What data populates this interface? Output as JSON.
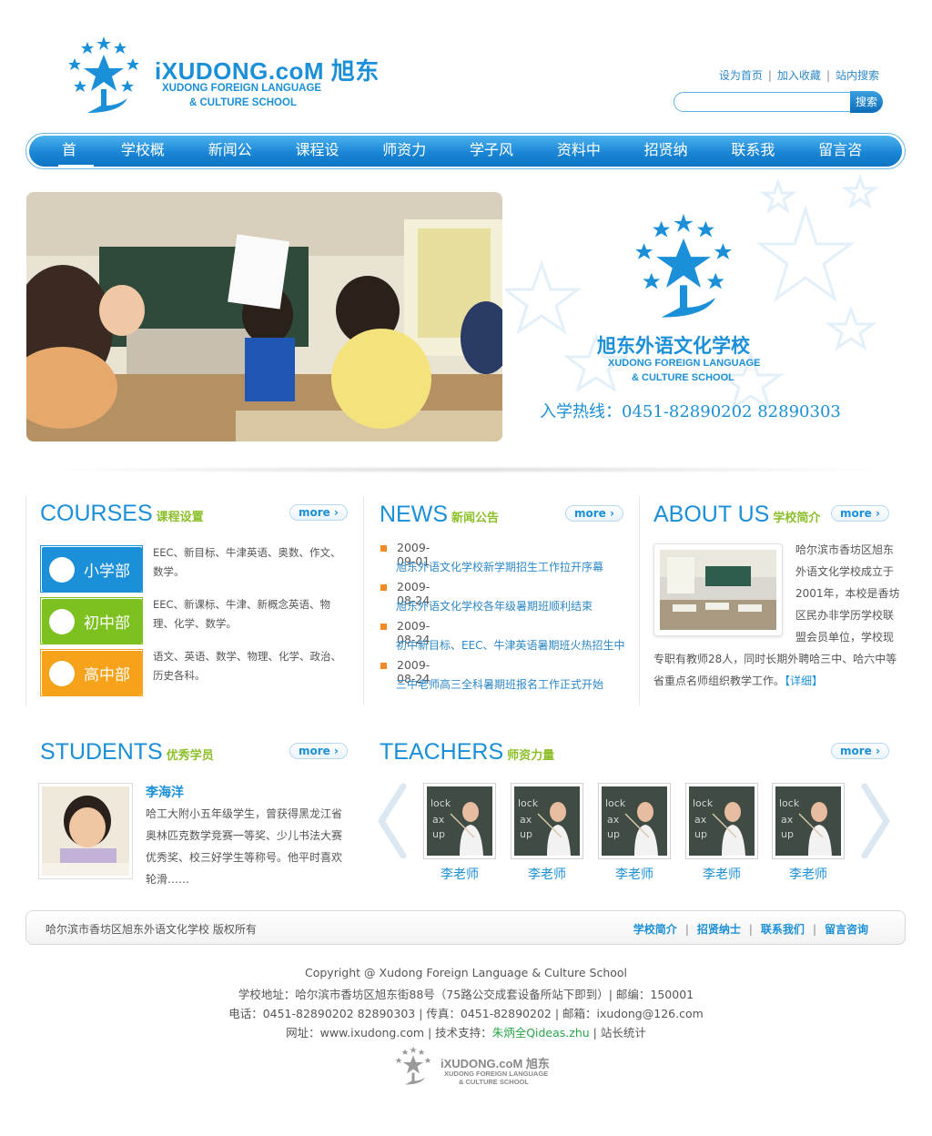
{
  "header": {
    "brand": "iXUDONG.coM 旭东",
    "brand_sub_1": "XUDONG FOREIGN LANGUAGE",
    "brand_sub_2": "& CULTURE SCHOOL",
    "top_links": [
      "设为首页",
      "加入收藏",
      "站内搜索"
    ],
    "search": {
      "placeholder": "",
      "button_label": "搜索"
    }
  },
  "nav": {
    "items": [
      "首页",
      "学校概况",
      "新闻公告",
      "课程设置",
      "师资力量",
      "学子风采",
      "资料中心",
      "招贤纳士",
      "联系我们",
      "留言咨询"
    ],
    "active_index": 0
  },
  "banner": {
    "school_name_cn": "旭东外语文化学校",
    "school_name_en_1": "XUDONG FOREIGN LANGUAGE",
    "school_name_en_2": "& CULTURE SCHOOL",
    "hotline": "入学热线：0451-82890202 82890303"
  },
  "courses": {
    "title": "COURSES",
    "subtitle": "课程设置",
    "more_label": "more",
    "items": [
      {
        "label": "小学部",
        "desc": "EEC、新目标、牛津英语、奥数、作文、数学。",
        "color": "#1b8fd8"
      },
      {
        "label": "初中部",
        "desc": "EEC、新课标、牛津、新概念英语、物理、化学、数学。",
        "color": "#7cc11f"
      },
      {
        "label": "高中部",
        "desc": "语文、英语、数学、物理、化学、政治、历史各科。",
        "color": "#f7a21b"
      }
    ]
  },
  "news": {
    "title": "NEWS",
    "subtitle": "新闻公告",
    "more_label": "more",
    "items": [
      {
        "date": "2009-09-01",
        "title": "旭东外语文化学校新学期招生工作拉开序幕"
      },
      {
        "date": "2009-08-24",
        "title": "旭东外语文化学校各年级暑期班顺利结束"
      },
      {
        "date": "2009-08-24",
        "title": "初中新目标、EEC、牛津英语暑期班火热招生中"
      },
      {
        "date": "2009-08-24",
        "title": "三中老师高三全科暑期班报名工作正式开始"
      }
    ]
  },
  "about": {
    "title": "ABOUT US",
    "subtitle": "学校简介",
    "more_label": "more",
    "text_side": [
      "哈尔滨市香坊区旭东",
      "外语文化学校成立于",
      "2001年，本校是香坊",
      "区民办非学历学校联",
      "盟会员单位，学校现"
    ],
    "text_full": [
      "专职有教师28人，同时长期外聘哈三中、哈六中等",
      "省重点名师组织教学工作。"
    ],
    "detail_link": "【详细】"
  },
  "students": {
    "title": "STUDENTS",
    "subtitle": "优秀学员",
    "more_label": "more",
    "name": "李海洋",
    "bio": "哈工大附小五年级学生，曾获得黑龙江省奥林匹克数学竞赛一等奖、少儿书法大赛优秀奖、校三好学生等称号。他平时喜欢轮滑……"
  },
  "teachers": {
    "title": "TEACHERS",
    "subtitle": "师资力量",
    "more_label": "more",
    "items": [
      "李老师",
      "李老师",
      "李老师",
      "李老师",
      "李老师"
    ]
  },
  "footer": {
    "left_text": "哈尔滨市香坊区旭东外语文化学校 版权所有",
    "links": [
      "学校简介",
      "招贤纳士",
      "联系我们",
      "留言咨询"
    ],
    "copyright": "Copyright @ Xudong Foreign Language & Culture School",
    "address": "学校地址：哈尔滨市香坊区旭东街88号（75路公交成套设备所站下即到）| 邮编：150001",
    "contact": "电话：0451-82890202 82890303 | 传真：0451-82890202 | 邮箱：ixudong@126.com",
    "site_prefix": "网址：www.ixudong.com | 技术支持：",
    "site_support": "朱炳全Qideas.zhu",
    "site_suffix": " | 站长统计",
    "logo_brand": "iXUDONG.coM 旭东",
    "logo_sub_1": "XUDONG FOREIGN LANGUAGE",
    "logo_sub_2": "& CULTURE SCHOOL"
  },
  "colors": {
    "primary": "#1b8fd8",
    "accent_green": "#8cbf2a",
    "accent_orange": "#f08a24"
  }
}
